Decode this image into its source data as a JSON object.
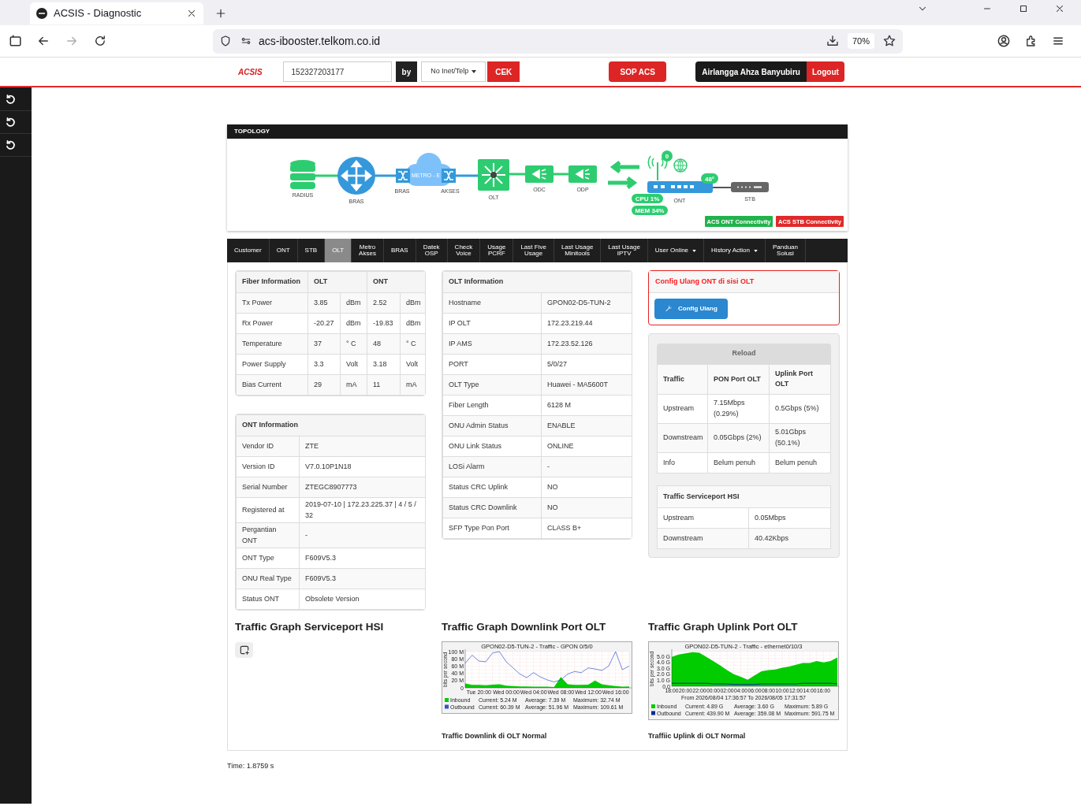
{
  "browser": {
    "tab_title": "ACSIS - Diagnostic",
    "url": "acs-ibooster.telkom.co.id",
    "zoom": "70%"
  },
  "header": {
    "logo": "ACSIS",
    "search_value": "152327203177",
    "by_label": "by",
    "search_type": "No Inet/Telp",
    "check_button": "CEK",
    "sop_button": "SOP ACS",
    "user_name": "Airlangga Ahza Banyubiru",
    "logout_button": "Logout"
  },
  "sidebar": {
    "items": [
      {
        "kind": "undo"
      },
      {
        "kind": "undo"
      },
      {
        "kind": "undo"
      }
    ]
  },
  "topology": {
    "title": "TOPOLOGY",
    "radius": "RADIUS",
    "bras": "BRAS",
    "metro_left": "BRAS",
    "metro": "METRO - E",
    "metro_right": "AKSES",
    "olt": "OLT",
    "odc": "ODC",
    "odp": "ODP",
    "ont": "ONT",
    "stb": "STB",
    "cpu": "CPU 1%",
    "mem": "MEM 34%",
    "temperature": "48°",
    "wifi_clients": "0",
    "badges": [
      {
        "label": "ACS ONT Connectivity",
        "color": "#22b24c"
      },
      {
        "label": "ACS STB Connectivity",
        "color": "#e02a2a"
      }
    ]
  },
  "tabs": [
    {
      "label": "Customer",
      "kind": "link",
      "selected": false
    },
    {
      "label": "ONT",
      "kind": "link",
      "selected": false
    },
    {
      "label": "STB",
      "kind": "link",
      "selected": false
    },
    {
      "label": "OLT",
      "kind": "link",
      "selected": true
    },
    {
      "label": "Metro\nAkses",
      "kind": "link",
      "selected": false
    },
    {
      "label": "BRAS",
      "kind": "link",
      "selected": false
    },
    {
      "label": "Datek\nOSP",
      "kind": "link",
      "selected": false
    },
    {
      "label": "Check\nVoice",
      "kind": "link",
      "selected": false
    },
    {
      "label": "Usage\nPCRF",
      "kind": "link",
      "selected": false
    },
    {
      "label": "Last Five\nUsage",
      "kind": "link",
      "selected": false
    },
    {
      "label": "Last Usage\nMinitools",
      "kind": "link",
      "selected": false
    },
    {
      "label": "Last Usage\nIPTV",
      "kind": "link",
      "selected": false
    },
    {
      "label": "User Online",
      "kind": "dropdown",
      "selected": false
    },
    {
      "label": "History Action",
      "kind": "dropdown",
      "selected": false
    },
    {
      "label": "Panduan\nSolusi",
      "kind": "link",
      "selected": false
    }
  ],
  "fiber_info": {
    "columns": [
      "Fiber Information",
      "OLT",
      "ONT"
    ],
    "rows": [
      {
        "label": "Tx Power",
        "olt": "3.85",
        "olt_unit": "dBm",
        "ont": "2.52",
        "ont_unit": "dBm"
      },
      {
        "label": "Rx Power",
        "olt": "-20.27",
        "olt_unit": "dBm",
        "ont": "-19.83",
        "ont_unit": "dBm"
      },
      {
        "label": "Temperature",
        "olt": "37",
        "olt_unit": "° C",
        "ont": "48",
        "ont_unit": "° C"
      },
      {
        "label": "Power Supply",
        "olt": "3.3",
        "olt_unit": "Volt",
        "ont": "3.18",
        "ont_unit": "Volt"
      },
      {
        "label": "Bias Current",
        "olt": "29",
        "olt_unit": "mA",
        "ont": "11",
        "ont_unit": "mA"
      }
    ]
  },
  "ont_info": {
    "title": "ONT Information",
    "rows": [
      {
        "label": "Vendor ID",
        "value": "ZTE"
      },
      {
        "label": "Version ID",
        "value": "V7.0.10P1N18"
      },
      {
        "label": "Serial Number",
        "value": "ZTEGC8907773"
      },
      {
        "label": "Registered at",
        "value": "2019-07-10 | 172.23.225.37 | 4 / 5 / 32"
      },
      {
        "label": "Pergantian ONT",
        "value": "-"
      },
      {
        "label": "ONT Type",
        "value": "F609V5.3"
      },
      {
        "label": "ONU Real Type",
        "value": "F609V5.3"
      },
      {
        "label": "Status ONT",
        "value": "Obsolete Version"
      }
    ]
  },
  "olt_info": {
    "title": "OLT Information",
    "rows": [
      {
        "label": "Hostname",
        "value": "GPON02-D5-TUN-2"
      },
      {
        "label": "IP OLT",
        "value": "172.23.219.44"
      },
      {
        "label": "IP AMS",
        "value": "172.23.52.126"
      },
      {
        "label": "PORT",
        "value": "5/0/27"
      },
      {
        "label": "OLT Type",
        "value": "Huawei - MA5600T"
      },
      {
        "label": "Fiber Length",
        "value": "6128 M"
      },
      {
        "label": "ONU Admin Status",
        "value": "ENABLE"
      },
      {
        "label": "ONU Link Status",
        "value": "ONLINE"
      },
      {
        "label": "LOSi Alarm",
        "value": "-"
      },
      {
        "label": "Status CRC Uplink",
        "value": "NO"
      },
      {
        "label": "Status CRC Downlink",
        "value": "NO"
      },
      {
        "label": "SFP Type Pon Port",
        "value": "CLASS B+"
      }
    ]
  },
  "config": {
    "title": "Config Ulang ONT di sisi OLT",
    "button": "Config Ulang"
  },
  "traffic": {
    "reload": "Reload",
    "columns": [
      "Traffic",
      "PON Port OLT",
      "Uplink Port OLT"
    ],
    "rows": [
      [
        "Upstream",
        "7.15Mbps (0.29%)",
        "0.5Gbps (5%)"
      ],
      [
        "Downstream",
        "0.05Gbps (2%)",
        "5.01Gbps (50.1%)"
      ],
      [
        "Info",
        "Belum penuh",
        "Belum penuh"
      ]
    ]
  },
  "serviceport": {
    "title": "Traffic Serviceport HSI",
    "rows": [
      [
        "Upstream",
        "0.05Mbps"
      ],
      [
        "Downstream",
        "40.42Kbps"
      ]
    ]
  },
  "graphs": [
    {
      "kind": "empty",
      "title": "Traffic Graph Serviceport HSI"
    },
    {
      "kind": "line",
      "title": "Traffic Graph Downlink Port OLT",
      "chart_data": {
        "type": "line",
        "title": "GPON02-D5-TUN-2 - Traffic - GPON 0/5/0",
        "ylabel": "bits per second",
        "ylim": [
          0,
          100
        ],
        "grid": true,
        "legend": "bottom",
        "categories": [
          null,
          null,
          "Tue 20:00",
          null,
          null,
          null,
          "Wed 00:00",
          null,
          null,
          null,
          "Wed 04:00",
          null,
          null,
          null,
          "Wed 08:00",
          null,
          null,
          null,
          "Wed 12:00",
          null,
          null,
          null,
          "Wed 16:00",
          null,
          null
        ],
        "yticks": [
          {
            "value": 100,
            "label": "100 M"
          },
          {
            "value": 80,
            "label": "80 M"
          },
          {
            "value": 60,
            "label": "60 M"
          },
          {
            "value": 40,
            "label": "40 M"
          },
          {
            "value": 20,
            "label": "20 M"
          },
          {
            "value": 0,
            "label": "0"
          }
        ],
        "series": [
          {
            "name": "Inbound",
            "type": "area",
            "color": "#00cc00",
            "values": [
              12,
              8,
              8,
              7,
              9,
              10,
              6,
              5,
              4,
              4,
              3,
              3,
              3,
              2,
              30,
              10,
              8,
              8,
              9,
              20,
              10,
              7,
              5,
              3,
              4
            ]
          },
          {
            "name": "Outbound",
            "type": "line",
            "color": "#3355cc",
            "values": [
              68,
              90,
              74,
              72,
              96,
              100,
              72,
              55,
              38,
              28,
              42,
              30,
              22,
              16,
              22,
              38,
              45,
              42,
              55,
              52,
              48,
              60,
              100,
              50,
              60
            ]
          }
        ]
      },
      "legend": [
        {
          "current": "Current: 5.24 M",
          "average": "Average: 7.39 M",
          "maximum": "Maximum: 32.74 M"
        },
        {
          "current": "Current: 60.39 M",
          "average": "Average: 51.96 M",
          "maximum": "Maximum: 109.61 M"
        }
      ],
      "caption": "Traffic Downlink di OLT Normal"
    },
    {
      "kind": "area",
      "title": "Traffic Graph Uplink Port OLT",
      "chart_data": {
        "type": "area",
        "title": "GPON02-D5-TUN-2 - Traffic - ethernet0/10/3",
        "ylabel": "bits per second",
        "ylim": [
          0,
          5.8
        ],
        "grid": true,
        "legend": "bottom",
        "categories": [
          "18:00",
          null,
          "20:00",
          null,
          "22:00",
          null,
          "00:00",
          null,
          "02:00",
          null,
          "04:00",
          null,
          "06:00",
          null,
          "08:00",
          null,
          "10:00",
          null,
          "12:00",
          null,
          "14:00",
          null,
          "16:00",
          null,
          null
        ],
        "yticks": [
          {
            "value": 5,
            "label": "5.0 G"
          },
          {
            "value": 4,
            "label": "4.0 G"
          },
          {
            "value": 3,
            "label": "3.0 G"
          },
          {
            "value": 2,
            "label": "2.0 G"
          },
          {
            "value": 1,
            "label": "1.0 G"
          },
          {
            "value": 0,
            "label": "0.0"
          }
        ],
        "series": [
          {
            "name": "Inbound",
            "type": "area",
            "color": "#00cc00",
            "values": [
              4.9,
              5.3,
              5.5,
              5.7,
              5.6,
              4.9,
              4.2,
              3.5,
              2.7,
              2.0,
              1.6,
              1.1,
              1.8,
              2.5,
              2.7,
              2.8,
              3.1,
              3.3,
              3.6,
              3.9,
              3.9,
              4.2,
              4.0,
              4.2,
              4.8
            ]
          },
          {
            "name": "Outbound",
            "type": "line",
            "color": "#002a97",
            "values": [
              0.5,
              0.5,
              0.5,
              0.5,
              0.5,
              0.5,
              0.4,
              0.4,
              0.4,
              0.3,
              0.3,
              0.3,
              0.3,
              0.4,
              0.4,
              0.4,
              0.4,
              0.4,
              0.4,
              0.5,
              0.5,
              0.5,
              0.5,
              0.5,
              0.4
            ]
          }
        ]
      },
      "period": "From 2026/08/04 17:36:57 To 2026/08/05 17:31:57",
      "legend": [
        {
          "current": "Current: 4.89 G",
          "average": "Average: 3.60 G",
          "maximum": "Maximum: 5.89 G"
        },
        {
          "current": "Current: 439.90 M",
          "average": "Average: 359.08 M",
          "maximum": "Maximum: 591.75 M"
        }
      ],
      "caption": "Traffiic Uplink di OLT Normal"
    }
  ],
  "footer": {
    "time": "Time: 1.8759 s"
  }
}
